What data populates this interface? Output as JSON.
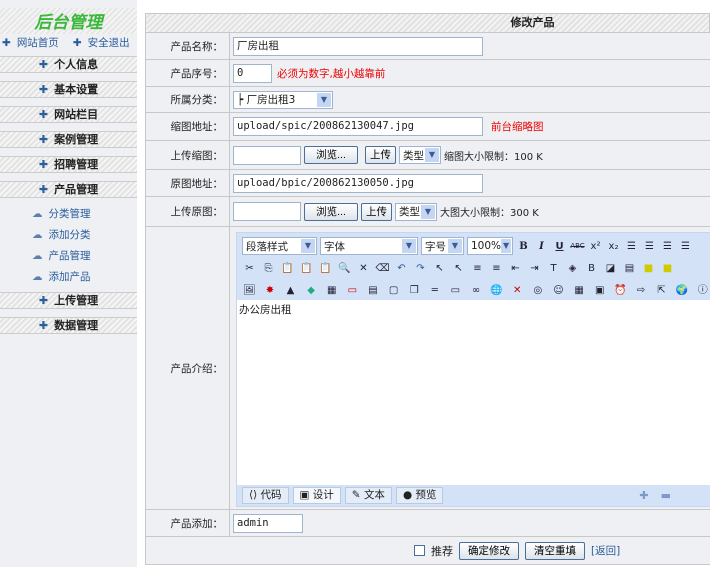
{
  "sidebar": {
    "logo": "后台管理",
    "links": [
      "网站首页",
      "安全退出"
    ],
    "sections": [
      "个人信息",
      "基本设置",
      "网站栏目",
      "案例管理",
      "招聘管理",
      "产品管理"
    ],
    "sub_items": [
      "分类管理",
      "添加分类",
      "产品管理",
      "添加产品"
    ],
    "sections_after": [
      "上传管理",
      "数据管理"
    ]
  },
  "main": {
    "title": "修改产品",
    "fields": {
      "name": {
        "label": "产品名称：",
        "value": "厂房出租"
      },
      "order": {
        "label": "产品序号：",
        "value": "0",
        "hint": "必须为数字,越小越靠前"
      },
      "category": {
        "label": "所属分类：",
        "value": "┝ 厂房出租3"
      },
      "thumb_url": {
        "label": "缩图地址：",
        "value": "upload/spic/200862130047.jpg",
        "hint": "前台缩略图"
      },
      "thumb_upload": {
        "label": "上传缩图：",
        "browse": "浏览...",
        "upload": "上传",
        "type": "类型",
        "limit": "缩图大小限制：100 K"
      },
      "image_url": {
        "label": "原图地址：",
        "value": "upload/bpic/200862130050.jpg"
      },
      "image_upload": {
        "label": "上传原图：",
        "browse": "浏览...",
        "upload": "上传",
        "type": "类型",
        "limit": "大图大小限制：300 K"
      },
      "intro": {
        "label": "产品介绍：",
        "content": "办公房出租"
      },
      "adder": {
        "label": "产品添加：",
        "value": "admin"
      }
    },
    "editor": {
      "paragraph": "段落样式",
      "font": "字体",
      "size": "字号",
      "zoom": "100%",
      "modes": [
        "代码",
        "设计",
        "文本",
        "预览"
      ]
    },
    "actions": {
      "recommend": "推荐",
      "submit": "确定修改",
      "reset": "清空重填",
      "back": "[返回]"
    }
  }
}
